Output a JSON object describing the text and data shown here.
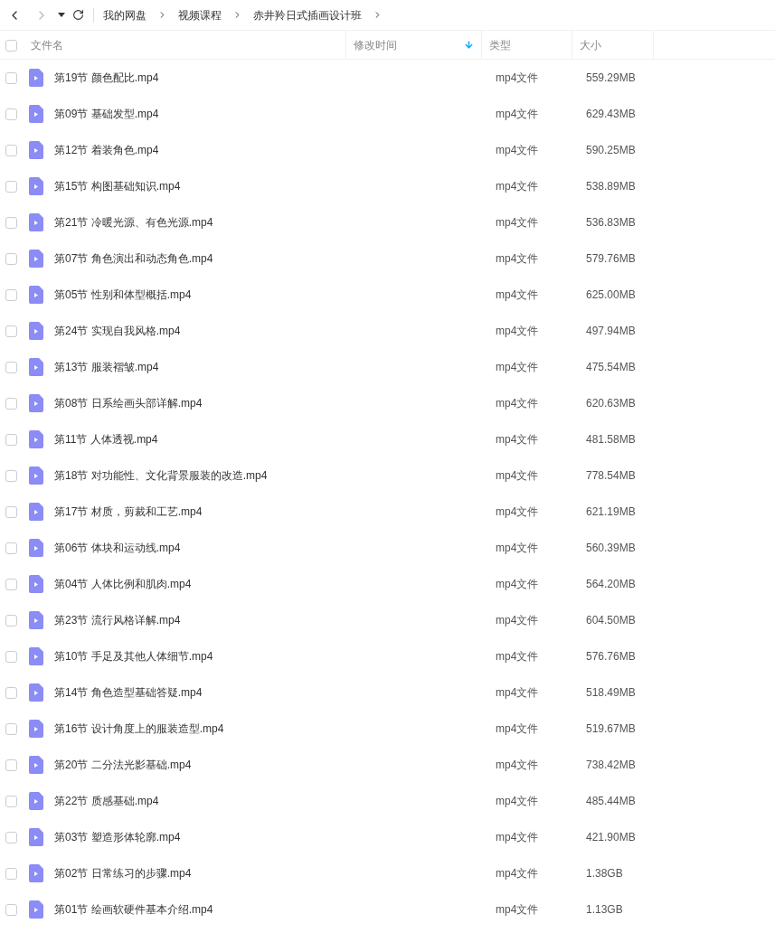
{
  "breadcrumbs": [
    "我的网盘",
    "视频课程",
    "赤井羚日式插画设计班"
  ],
  "table": {
    "all_checked": false,
    "columns": [
      {
        "label": "文件名",
        "sorted": false
      },
      {
        "label": "修改时间",
        "sorted": true
      },
      {
        "label": "类型",
        "sorted": false
      },
      {
        "label": "大小",
        "sorted": false
      }
    ],
    "rows": [
      {
        "name": "第19节 颜色配比.mp4",
        "type": "mp4文件",
        "size": "559.29MB",
        "checked": false
      },
      {
        "name": "第09节 基础发型.mp4",
        "type": "mp4文件",
        "size": "629.43MB",
        "checked": false
      },
      {
        "name": "第12节 着装角色.mp4",
        "type": "mp4文件",
        "size": "590.25MB",
        "checked": false
      },
      {
        "name": "第15节 构图基础知识.mp4",
        "type": "mp4文件",
        "size": "538.89MB",
        "checked": false
      },
      {
        "name": "第21节 冷暖光源、有色光源.mp4",
        "type": "mp4文件",
        "size": "536.83MB",
        "checked": false
      },
      {
        "name": "第07节 角色演出和动态角色.mp4",
        "type": "mp4文件",
        "size": "579.76MB",
        "checked": false
      },
      {
        "name": "第05节 性别和体型概括.mp4",
        "type": "mp4文件",
        "size": "625.00MB",
        "checked": false
      },
      {
        "name": "第24节 实现自我风格.mp4",
        "type": "mp4文件",
        "size": "497.94MB",
        "checked": false
      },
      {
        "name": "第13节 服装褶皱.mp4",
        "type": "mp4文件",
        "size": "475.54MB",
        "checked": false
      },
      {
        "name": "第08节 日系绘画头部详解.mp4",
        "type": "mp4文件",
        "size": "620.63MB",
        "checked": false
      },
      {
        "name": "第11节 人体透视.mp4",
        "type": "mp4文件",
        "size": "481.58MB",
        "checked": false
      },
      {
        "name": "第18节 对功能性、文化背景服装的改造.mp4",
        "type": "mp4文件",
        "size": "778.54MB",
        "checked": false
      },
      {
        "name": "第17节 材质，剪裁和工艺.mp4",
        "type": "mp4文件",
        "size": "621.19MB",
        "checked": false
      },
      {
        "name": "第06节 体块和运动线.mp4",
        "type": "mp4文件",
        "size": "560.39MB",
        "checked": false
      },
      {
        "name": "第04节 人体比例和肌肉.mp4",
        "type": "mp4文件",
        "size": "564.20MB",
        "checked": false
      },
      {
        "name": "第23节 流行风格详解.mp4",
        "type": "mp4文件",
        "size": "604.50MB",
        "checked": false
      },
      {
        "name": "第10节 手足及其他人体细节.mp4",
        "type": "mp4文件",
        "size": "576.76MB",
        "checked": false
      },
      {
        "name": "第14节 角色造型基础答疑.mp4",
        "type": "mp4文件",
        "size": "518.49MB",
        "checked": false
      },
      {
        "name": "第16节 设计角度上的服装造型.mp4",
        "type": "mp4文件",
        "size": "519.67MB",
        "checked": false
      },
      {
        "name": "第20节 二分法光影基础.mp4",
        "type": "mp4文件",
        "size": "738.42MB",
        "checked": false
      },
      {
        "name": "第22节 质感基础.mp4",
        "type": "mp4文件",
        "size": "485.44MB",
        "checked": false
      },
      {
        "name": "第03节 塑造形体轮廓.mp4",
        "type": "mp4文件",
        "size": "421.90MB",
        "checked": false
      },
      {
        "name": "第02节 日常练习的步骤.mp4",
        "type": "mp4文件",
        "size": "1.38GB",
        "checked": false
      },
      {
        "name": "第01节 绘画软硬件基本介绍.mp4",
        "type": "mp4文件",
        "size": "1.13GB",
        "checked": false
      }
    ]
  }
}
